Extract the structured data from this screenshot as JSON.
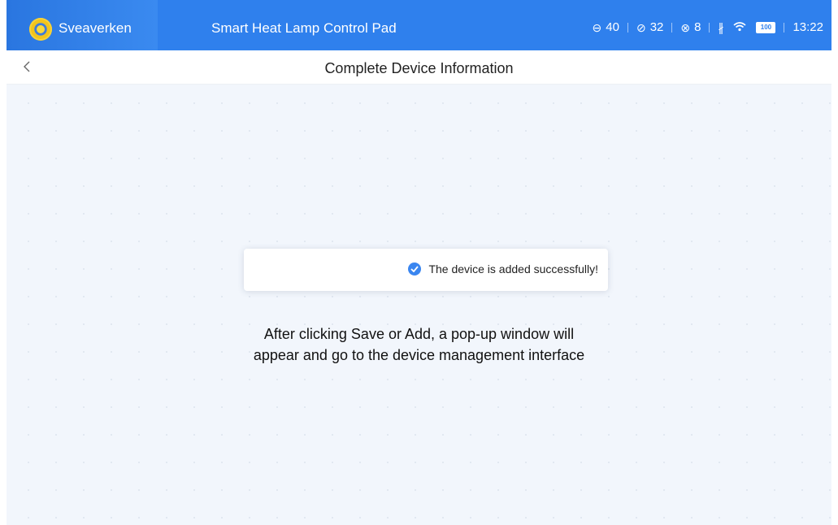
{
  "header": {
    "brand": "Sveaverken",
    "app_title": "Smart Heat Lamp Control Pad",
    "status": {
      "stat1_icon": "rotate-icon",
      "stat1_value": "40",
      "stat2_icon": "link-icon",
      "stat2_value": "32",
      "stat3_icon": "unlink-icon",
      "stat3_value": "8",
      "battery": "100",
      "time": "13:22"
    }
  },
  "nav": {
    "title": "Complete Device Information"
  },
  "toast": {
    "message": "The device is added successfully!"
  },
  "hint": {
    "line1": "After clicking Save or Add, a pop-up window will",
    "line2": "appear and go to the device management interface"
  },
  "colors": {
    "primary": "#2f80ed",
    "background": "#f2f6fc",
    "success_icon": "#3a86f0"
  }
}
